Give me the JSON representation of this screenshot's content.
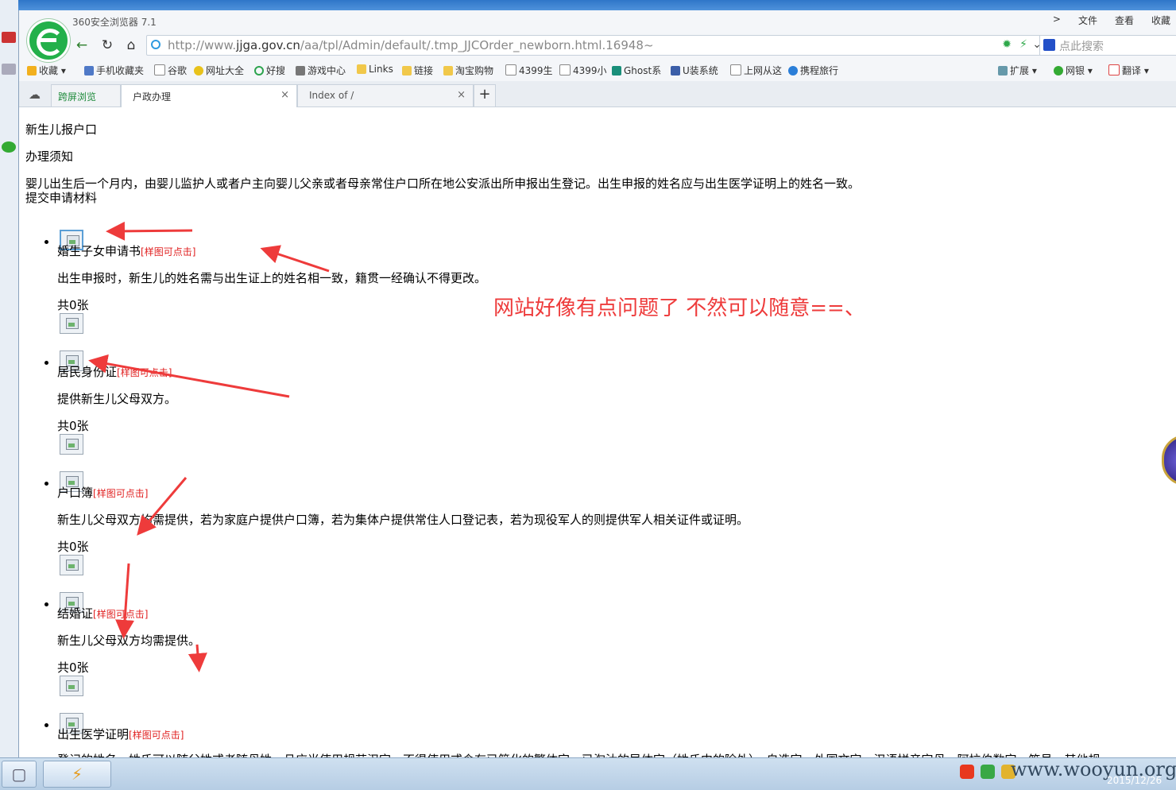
{
  "browser": {
    "title": "360安全浏览器 7.1",
    "menu": [
      "文件",
      "查看",
      "收藏"
    ],
    "menu_prefix": ">",
    "url_prefix": "http://www.",
    "url_domain": "jjga.gov.cn",
    "url_path": "/aa/tpl/Admin/default/.tmp_JJCOrder_newborn.html.16948~",
    "search_placeholder": "点此搜索"
  },
  "bookmarks_left": [
    "收藏",
    "手机收藏夹",
    "谷歌",
    "网址大全",
    "好搜",
    "游戏中心",
    "Links",
    "链接",
    "淘宝购物",
    "4399生",
    "4399小",
    "Ghost系",
    "U装系统",
    "上网从这",
    "携程旅行"
  ],
  "bookmarks_right": [
    "扩展",
    "网银",
    "翻译"
  ],
  "tabs": [
    {
      "label": "跨屏浏览"
    },
    {
      "label": "户政办理"
    },
    {
      "label": "Index of /"
    }
  ],
  "page": {
    "heading": "新生儿报户口",
    "notice_title": "办理须知",
    "notice_text": "婴儿出生后一个月内，由婴儿监护人或者户主向婴儿父亲或者母亲常住户口所在地公安派出所申报出生登记。出生申报的姓名应与出生医学证明上的姓名一致。",
    "materials_title": "提交申请材料",
    "sample_link": "[样图可点击]",
    "count_text": "共0张",
    "items": [
      {
        "name": "婚生子女申请书",
        "desc": "出生申报时，新生儿的姓名需与出生证上的姓名相一致，籍贯一经确认不得更改。"
      },
      {
        "name": "居民身份证",
        "desc": "提供新生儿父母双方。"
      },
      {
        "name": "户口簿",
        "desc": "新生儿父母双方均需提供，若为家庭户提供户口簿，若为集体户提供常住人口登记表，若为现役军人的则提供军人相关证件或证明。"
      },
      {
        "name": "结婚证",
        "desc": "新生儿父母双方均需提供。"
      },
      {
        "name": "出生医学证明",
        "desc": "登记的姓名、姓氏可以随父姓或者随母姓，且应当使用规范汉字，不得使用或含有已简化的繁体字、已淘汰的异体字（姓氏中的除外）、自造字、外国文字、汉语拼音字母、阿拉伯数字、符号、其他规"
      }
    ],
    "annotation": "网站好像有点问题了  不然可以随意==、"
  },
  "taskbar": {
    "watermark": "www.wooyun.org",
    "date": "2015/12/26"
  },
  "colors": {
    "accent_red": "#e02020",
    "annotation_red": "#ee3b3b",
    "logo_green": "#23b04a"
  }
}
